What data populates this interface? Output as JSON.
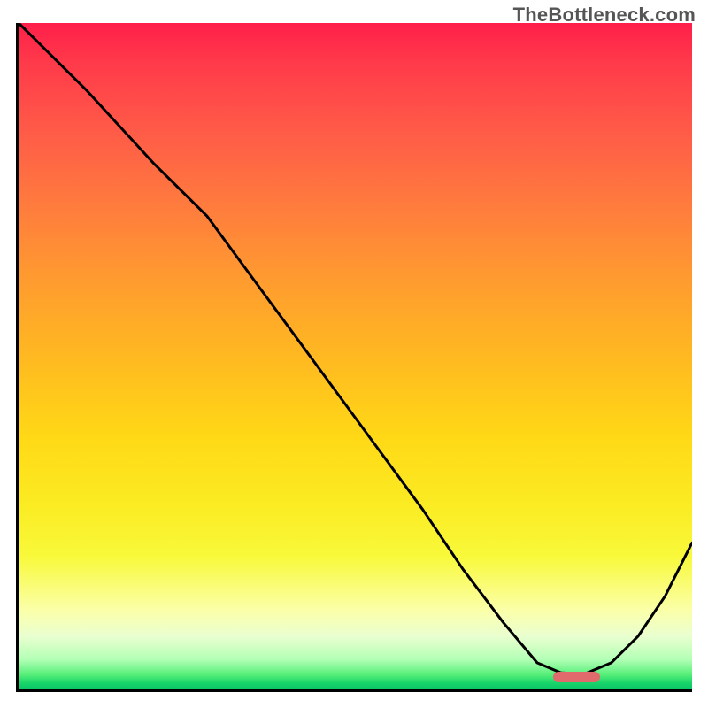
{
  "watermark": "TheBottleneck.com",
  "chart_data": {
    "type": "line",
    "title": "",
    "xlabel": "",
    "ylabel": "",
    "xlim": [
      0,
      100
    ],
    "ylim": [
      0,
      100
    ],
    "series": [
      {
        "name": "bottleneck-curve",
        "x": [
          0,
          10,
          20,
          28,
          36,
          44,
          52,
          60,
          66,
          72,
          77,
          80.5,
          84,
          88,
          92,
          96,
          100
        ],
        "y": [
          100,
          90,
          79,
          71,
          60,
          49,
          38,
          27,
          18,
          10,
          4,
          2.5,
          2.3,
          4,
          8,
          14,
          22
        ]
      }
    ],
    "gradient_stops": [
      {
        "pos": 0.0,
        "color": "#ff1f4a"
      },
      {
        "pos": 0.16,
        "color": "#ff5a48"
      },
      {
        "pos": 0.38,
        "color": "#ff9a30"
      },
      {
        "pos": 0.62,
        "color": "#ffd816"
      },
      {
        "pos": 0.8,
        "color": "#f8f93a"
      },
      {
        "pos": 0.92,
        "color": "#eaffd0"
      },
      {
        "pos": 0.978,
        "color": "#56ee78"
      },
      {
        "pos": 1.0,
        "color": "#0ac567"
      }
    ],
    "optimal_marker": {
      "x_start": 79,
      "x_end": 86,
      "y": 2.3,
      "color": "#e06a6c"
    },
    "legend": []
  }
}
